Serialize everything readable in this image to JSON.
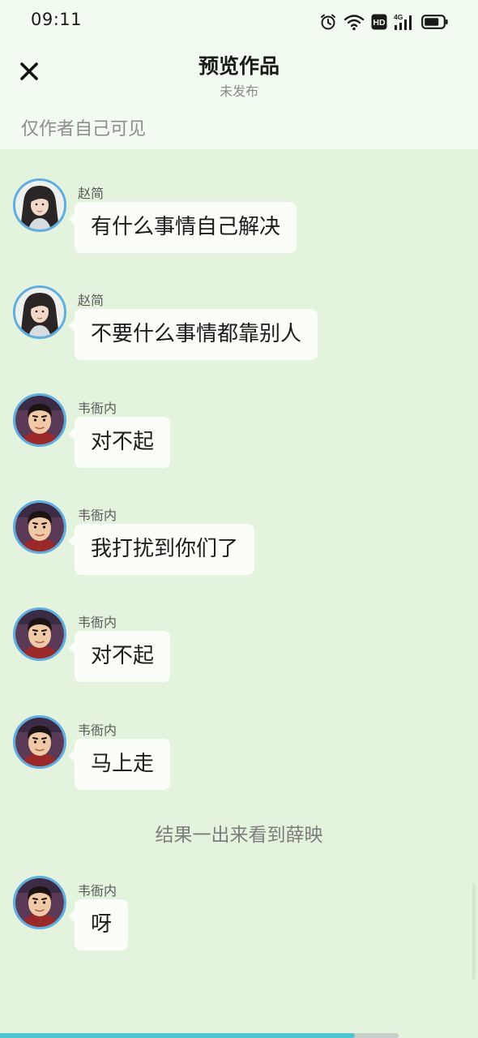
{
  "status_bar": {
    "time": "09:11",
    "icons": [
      "alarm-icon",
      "wifi-icon",
      "hd-icon",
      "signal-4g-icon",
      "battery-icon"
    ],
    "network_label": "4G",
    "hd_label": "HD"
  },
  "header": {
    "close_icon": "close-icon",
    "title": "预览作品",
    "subtitle": "未发布",
    "visibility_note": "仅作者自己可见"
  },
  "messages": [
    {
      "sender": "赵简",
      "avatar": "avatar-zhaojian",
      "text": "有什么事情自己解决"
    },
    {
      "sender": "赵简",
      "avatar": "avatar-zhaojian",
      "text": "不要什么事情都靠别人"
    },
    {
      "sender": "韦衙内",
      "avatar": "avatar-weiyanei",
      "text": "对不起"
    },
    {
      "sender": "韦衙内",
      "avatar": "avatar-weiyanei",
      "text": "我打扰到你们了"
    },
    {
      "sender": "韦衙内",
      "avatar": "avatar-weiyanei",
      "text": "对不起"
    },
    {
      "sender": "韦衙内",
      "avatar": "avatar-weiyanei",
      "text": "马上走"
    },
    {
      "sender": "韦衙内",
      "avatar": "avatar-weiyanei",
      "text": "呀"
    }
  ],
  "narration": "结果一出来看到薛映",
  "progress": {
    "fraction": 0.89
  },
  "colors": {
    "background": "#e4f3dd",
    "header_background": "#f1fbef",
    "bubble": "#fafdf8",
    "avatar_border": "#5eaee0",
    "progress": "#4cc6d0"
  }
}
